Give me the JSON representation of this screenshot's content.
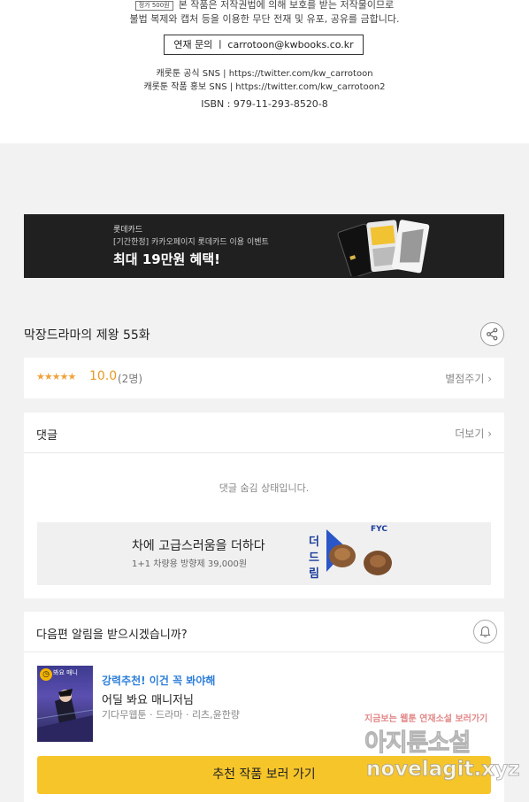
{
  "copyright": {
    "price": "정가 500원",
    "line1": "본 작품은 저작권법에 의해 보호를 받는 저작물이므로",
    "line2": "불법 복제와 캡처 등을 이용한 무단 전재 및 유포, 공유를 금합니다.",
    "contact": "연재 문의 ㅣ carrotoon@kwbooks.co.kr",
    "sns_official": "캐롯툰 공식 SNS | https://twitter.com/kw_carrotoon",
    "sns_promo": "캐롯툰 작품 홍보 SNS | https://twitter.com/kw_carrotoon2",
    "isbn": "ISBN : 979-11-293-8520-8"
  },
  "banner": {
    "brand": "롯데카드",
    "subtitle": "[기간한정] 카카오페이지 롯데카드 이용 이벤트",
    "title": "최대 19만원 혜택!"
  },
  "episode": {
    "title": "막장드라마의 제왕 55화"
  },
  "rating": {
    "stars": "★★★★★",
    "score": "10.0",
    "count": "(2명)",
    "rate_link": "별점주기 ›"
  },
  "comments": {
    "title": "댓글",
    "more": "더보기 ›",
    "hidden_message": "댓글 숨김 상태입니다."
  },
  "ad": {
    "title": "차에 고급스러움을 더하다",
    "subtitle": "1+1 차량용 방향제 39,000원",
    "brand_text": "FYC",
    "vertical_text": "더드림"
  },
  "next": {
    "question": "다음편 알림을 받으시겠습니까?",
    "thumb_text": "봐요 매니",
    "rec_tag": "강력추천! 이건 꼭 봐야해",
    "rec_name": "어딜 봐요 매니저님",
    "rec_meta": "기다무웹툰 · 드라마 · 리츠,윤한량",
    "rec_button": "추천 작품 보러 가기"
  },
  "watermark": {
    "line1": "지금보는 웹툰 연재소설 보러가기",
    "line2": "아지툰소설",
    "line3": "novelagit.xyz"
  },
  "colors": {
    "accent_yellow": "#f6c52a",
    "star_orange": "#f1a23a",
    "link_blue": "#2e7fd9"
  }
}
